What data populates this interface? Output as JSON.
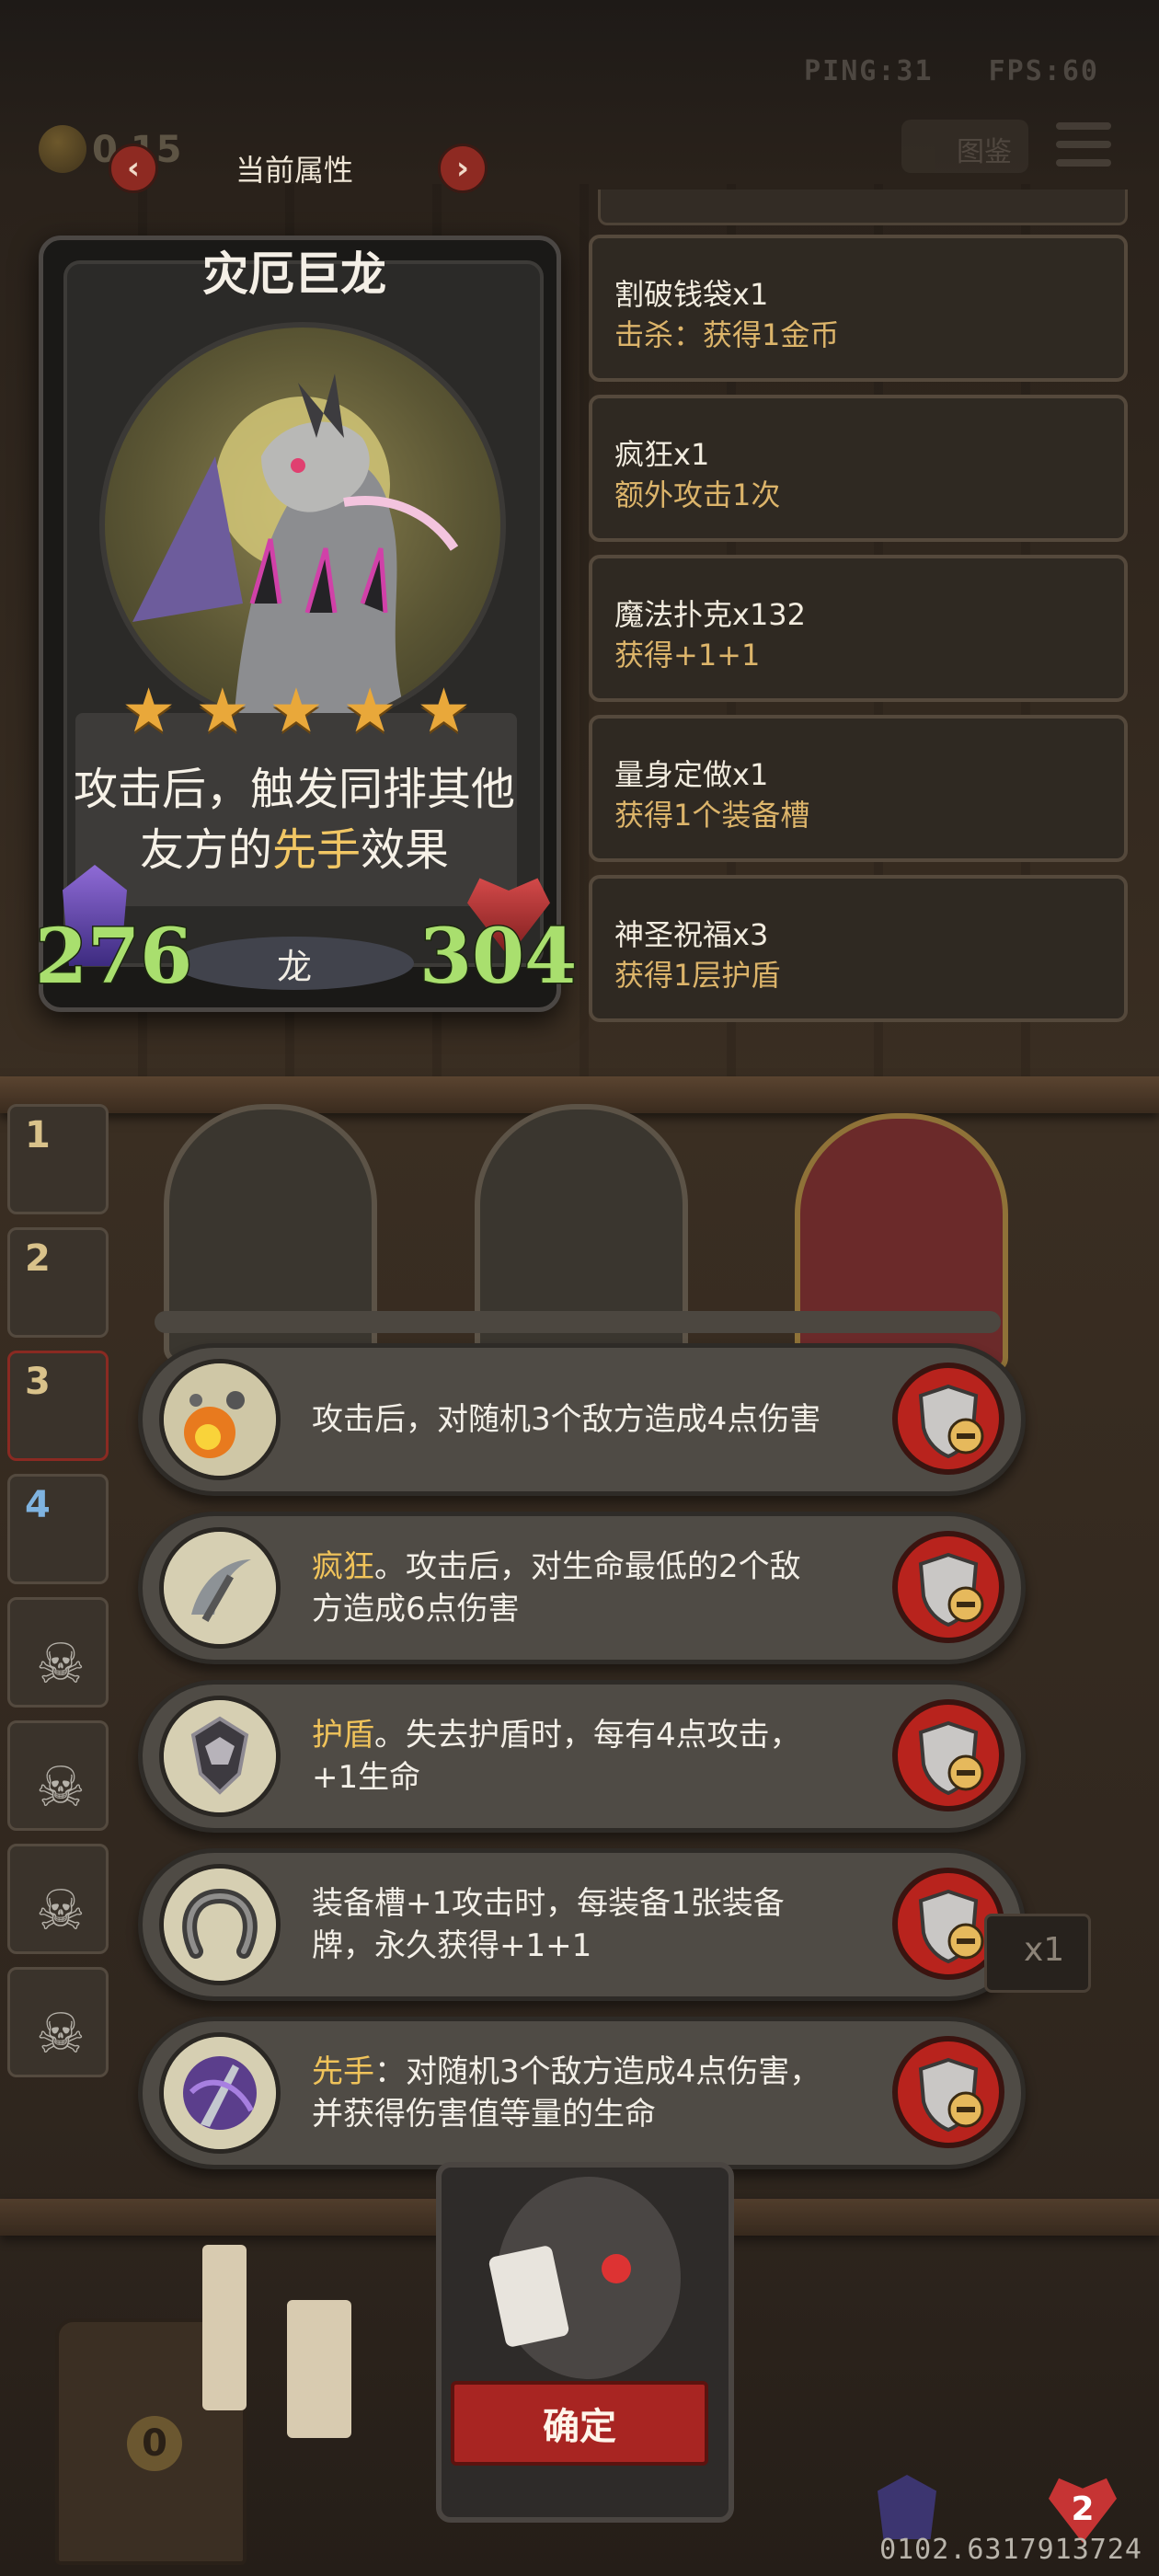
{
  "status": {
    "ping": "PING:31",
    "fps": "FPS:60"
  },
  "gold": {
    "value": "0  15"
  },
  "header": {
    "title": "当前属性",
    "prev_icon": "chevron-left-icon",
    "next_icon": "chevron-right-icon",
    "guide_label": "图鉴"
  },
  "card": {
    "name": "灾厄巨龙",
    "stars": 5,
    "desc_before": "攻击后，触发同排其他友方的",
    "desc_highlight": "先手",
    "desc_after": "效果",
    "type": "龙",
    "attack": "276",
    "health": "304"
  },
  "effects": [
    {
      "name": "割破钱袋x1",
      "desc": "击杀：获得1金币"
    },
    {
      "name": "疯狂x1",
      "desc": "额外攻击1次"
    },
    {
      "name": "魔法扑克x132",
      "desc": "获得+1+1"
    },
    {
      "name": "量身定做x1",
      "desc": "获得1个装备槽"
    },
    {
      "name": "神圣祝福x3",
      "desc": "获得1层护盾"
    }
  ],
  "slots": [
    "1",
    "2",
    "3",
    "4"
  ],
  "skills": [
    {
      "icon": "explosion-icon",
      "hl": "",
      "text": "攻击后，对随机3个敌方造成4点伤害"
    },
    {
      "icon": "scythe-icon",
      "hl": "疯狂",
      "text": "。攻击后，对生命最低的2个敌方造成6点伤害"
    },
    {
      "icon": "dragon-shield-icon",
      "hl": "护盾",
      "text": "。失去护盾时，每有4点攻击，+1生命"
    },
    {
      "icon": "horseshoe-icon",
      "hl": "",
      "text": "装备槽+1攻击时，每装备1张装备牌，永久获得+1+1"
    },
    {
      "icon": "shadow-dagger-icon",
      "hl": "先手",
      "text": "：对随机3个敌方造成4点伤害，并获得伤害值等量的生命"
    }
  ],
  "confirm_label": "确定",
  "chest_count": "0",
  "hero_hp": "2",
  "side_badge": "x1",
  "coords": "0102.6317913724",
  "colors": {
    "accent_red": "#a82522",
    "highlight_gold": "#f0c35a",
    "stat_green": "#a9df6e"
  }
}
